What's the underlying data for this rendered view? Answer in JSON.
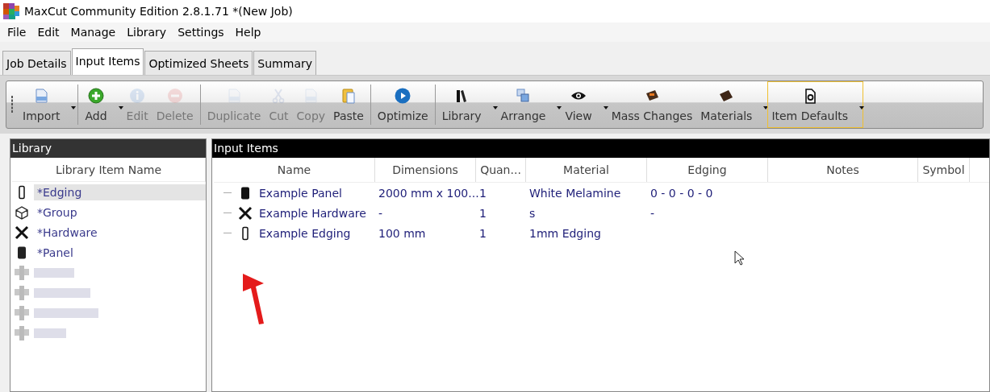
{
  "window": {
    "title": "MaxCut Community Edition 2.8.1.71 *(New Job)"
  },
  "menu": [
    "File",
    "Edit",
    "Manage",
    "Library",
    "Settings",
    "Help"
  ],
  "tabs": [
    {
      "label": "Job Details",
      "selected": false
    },
    {
      "label": "Input Items",
      "selected": true
    },
    {
      "label": "Optimized Sheets",
      "selected": false
    },
    {
      "label": "Summary",
      "selected": false
    }
  ],
  "toolbar": [
    [
      {
        "label": "Import",
        "kind": "import",
        "disabled": false,
        "dropdown": true,
        "highlighted": false
      }
    ],
    [
      {
        "label": "Add",
        "kind": "add",
        "disabled": false,
        "dropdown": true,
        "highlighted": false
      },
      {
        "label": "Edit",
        "kind": "info",
        "disabled": true,
        "dropdown": false,
        "highlighted": false
      },
      {
        "label": "Delete",
        "kind": "delete",
        "disabled": true,
        "dropdown": false,
        "highlighted": false
      }
    ],
    [
      {
        "label": "Duplicate",
        "kind": "doc",
        "disabled": true,
        "dropdown": false,
        "highlighted": false
      },
      {
        "label": "Cut",
        "kind": "cut",
        "disabled": true,
        "dropdown": false,
        "highlighted": false
      },
      {
        "label": "Copy",
        "kind": "doc",
        "disabled": true,
        "dropdown": false,
        "highlighted": false
      },
      {
        "label": "Paste",
        "kind": "paste",
        "disabled": false,
        "dropdown": false,
        "highlighted": false
      }
    ],
    [
      {
        "label": "Optimize",
        "kind": "play",
        "disabled": false,
        "dropdown": false,
        "highlighted": false
      }
    ],
    [
      {
        "label": "Library",
        "kind": "books",
        "disabled": false,
        "dropdown": true,
        "highlighted": false
      },
      {
        "label": "Arrange",
        "kind": "arrange",
        "disabled": false,
        "dropdown": true,
        "highlighted": false
      },
      {
        "label": "View",
        "kind": "eye",
        "disabled": false,
        "dropdown": true,
        "highlighted": false
      },
      {
        "label": "Mass Changes",
        "kind": "mass",
        "disabled": false,
        "dropdown": false,
        "highlighted": false
      },
      {
        "label": "Materials",
        "kind": "material",
        "disabled": false,
        "dropdown": true,
        "highlighted": false
      },
      {
        "label": "Item Defaults",
        "kind": "defaults",
        "disabled": false,
        "dropdown": true,
        "highlighted": true
      }
    ]
  ],
  "library": {
    "title": "Library",
    "column": "Library Item Name",
    "items": [
      {
        "kind": "edging",
        "label": "*Edging",
        "selected": true
      },
      {
        "kind": "group",
        "label": "*Group",
        "selected": false
      },
      {
        "kind": "hardware",
        "label": "*Hardware",
        "selected": false
      },
      {
        "kind": "panel",
        "label": "*Panel",
        "selected": false
      },
      {
        "kind": "redacted"
      },
      {
        "kind": "redacted"
      },
      {
        "kind": "redacted"
      },
      {
        "kind": "redacted"
      }
    ]
  },
  "input_items": {
    "title": "Input Items",
    "columns": [
      "Name",
      "Dimensions",
      "Quan...",
      "Material",
      "Edging",
      "Notes",
      "Symbol"
    ],
    "rows": [
      {
        "kind": "panel",
        "cells": [
          "Example Panel",
          "2000 mm x 100...",
          "1",
          "White Melamine",
          "0 - 0 - 0 - 0"
        ]
      },
      {
        "kind": "hardware",
        "cells": [
          "Example Hardware",
          "-",
          "1",
          "s",
          "-"
        ]
      },
      {
        "kind": "edging",
        "cells": [
          "Example Edging",
          "100 mm",
          "1",
          "1mm Edging"
        ]
      }
    ]
  }
}
